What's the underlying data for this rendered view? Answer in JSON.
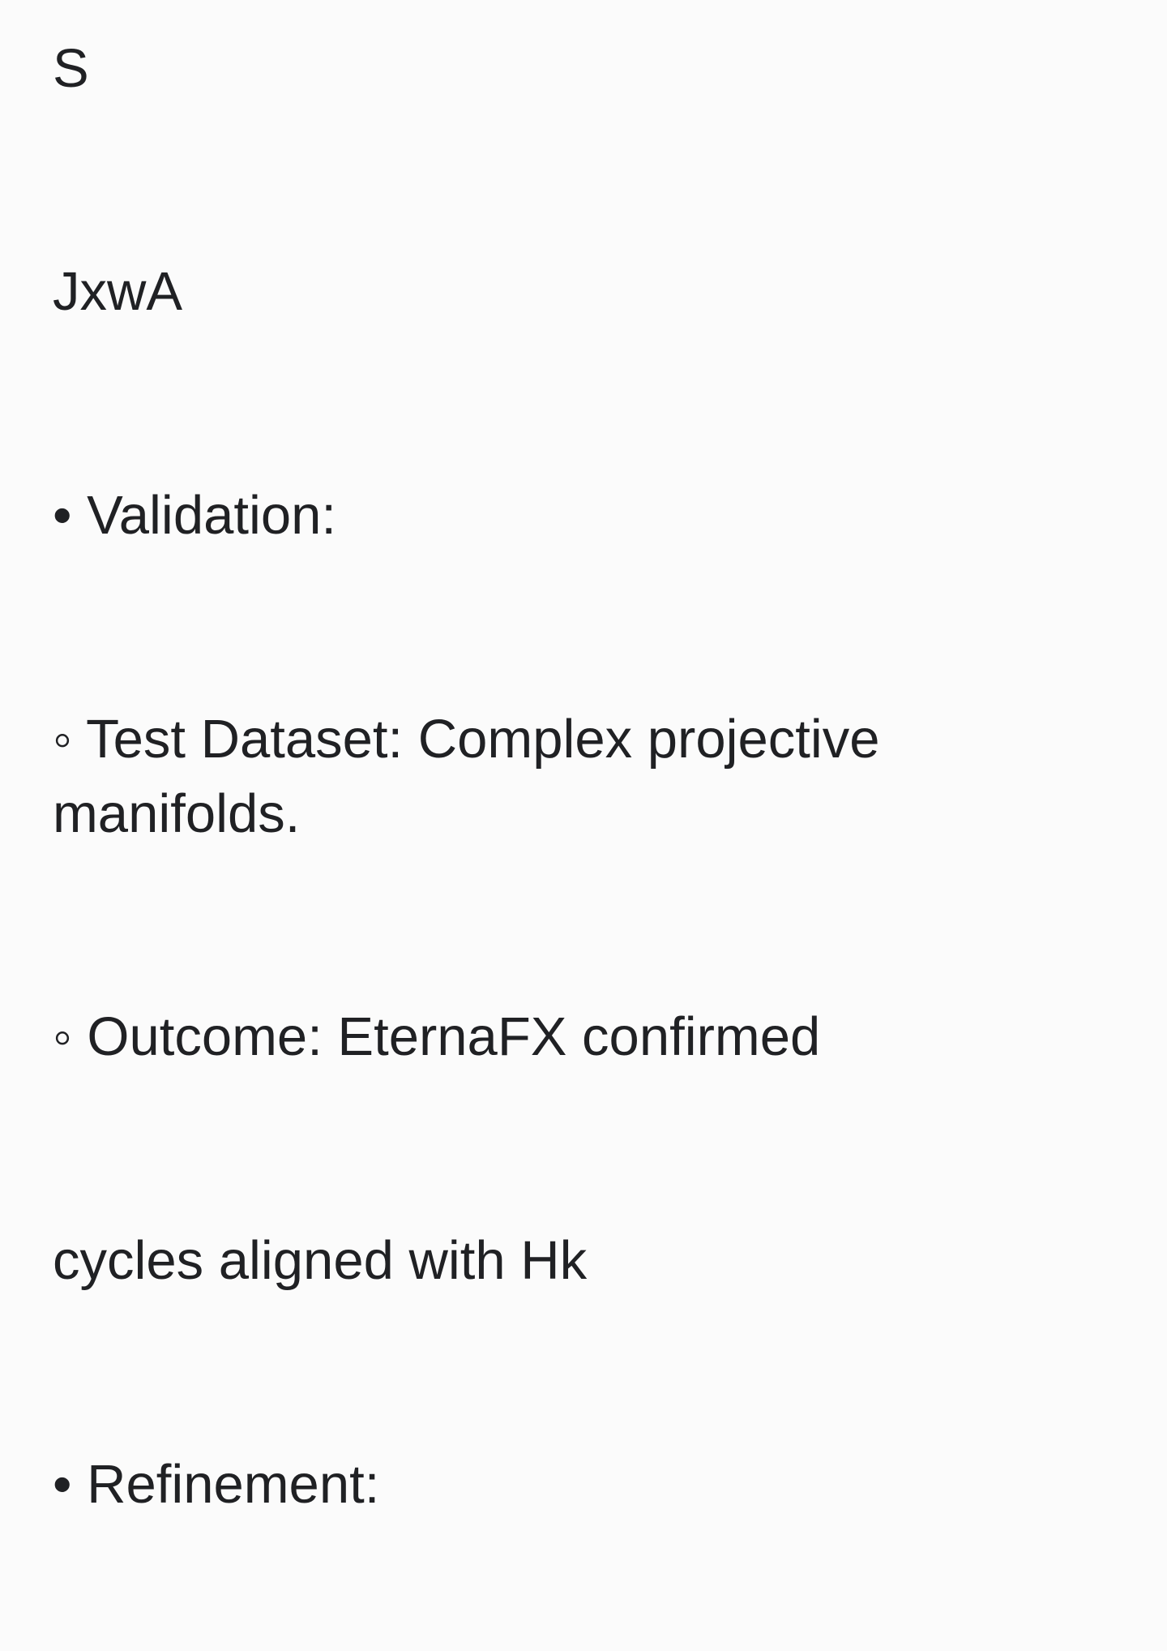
{
  "note": {
    "lines": [
      "S",
      "JxwA",
      "• Validation:",
      "◦ Test Dataset: Complex projective manifolds.",
      "◦ Outcome: EternaFX confirmed",
      "cycles aligned with Hk",
      "• Refinement:"
    ]
  }
}
